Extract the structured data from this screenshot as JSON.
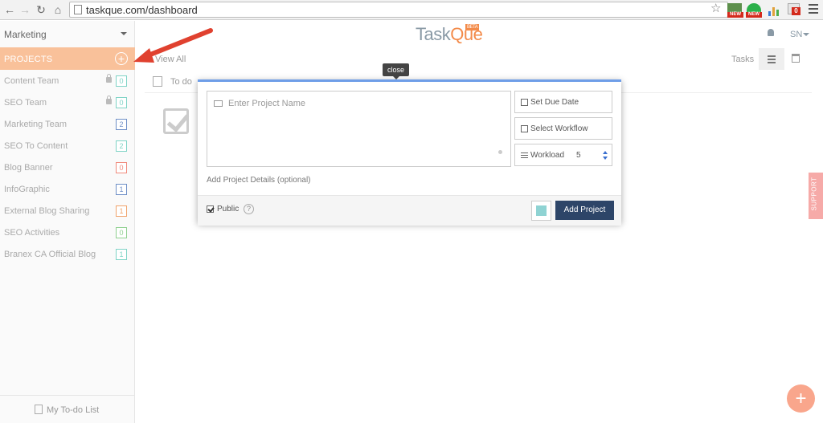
{
  "browser": {
    "url": "taskque.com/dashboard",
    "ext_new_1": "NEW",
    "ext_new_2": "NEW",
    "badge_count": "0"
  },
  "sidebar": {
    "team": "Marketing",
    "projects_header": "PROJECTS",
    "add_symbol": "+",
    "items": [
      {
        "name": "Content Team",
        "count": "0",
        "locked": true,
        "color": "#7fd3c6"
      },
      {
        "name": "SEO Team",
        "count": "0",
        "locked": true,
        "color": "#7fd3c6"
      },
      {
        "name": "Marketing Team",
        "count": "2",
        "locked": false,
        "color": "#6f8fc7"
      },
      {
        "name": "SEO To Content",
        "count": "2",
        "locked": false,
        "color": "#7fd3c6"
      },
      {
        "name": "Blog Banner",
        "count": "0",
        "locked": false,
        "color": "#f08a7c"
      },
      {
        "name": "InfoGraphic",
        "count": "1",
        "locked": false,
        "color": "#6f8fc7"
      },
      {
        "name": "External Blog Sharing",
        "count": "1",
        "locked": false,
        "color": "#f0a36c"
      },
      {
        "name": "SEO Activities",
        "count": "0",
        "locked": false,
        "color": "#8fd08f"
      },
      {
        "name": "Branex CA Official Blog",
        "count": "1",
        "locked": false,
        "color": "#7fd3c6"
      }
    ],
    "todo_list": "My To-do List"
  },
  "header": {
    "logo_task": "Task",
    "logo_que": "Que",
    "logo_beta": "BETA",
    "user": "SN"
  },
  "subbar": {
    "view_all": "View All",
    "tasks": "Tasks"
  },
  "todo_row": "To do",
  "tooltip": "close",
  "modal": {
    "name_placeholder": "Enter Project Name",
    "due_date": "Set Due Date",
    "workflow": "Select Workflow",
    "workload_label": "Workload",
    "workload_value": "5",
    "details_link": "Add Project Details (optional)",
    "public_label": "Public",
    "help": "?",
    "swatch_color": "#8fd3d3",
    "add_button": "Add Project"
  },
  "support": "SUPPORT",
  "fab": "+"
}
